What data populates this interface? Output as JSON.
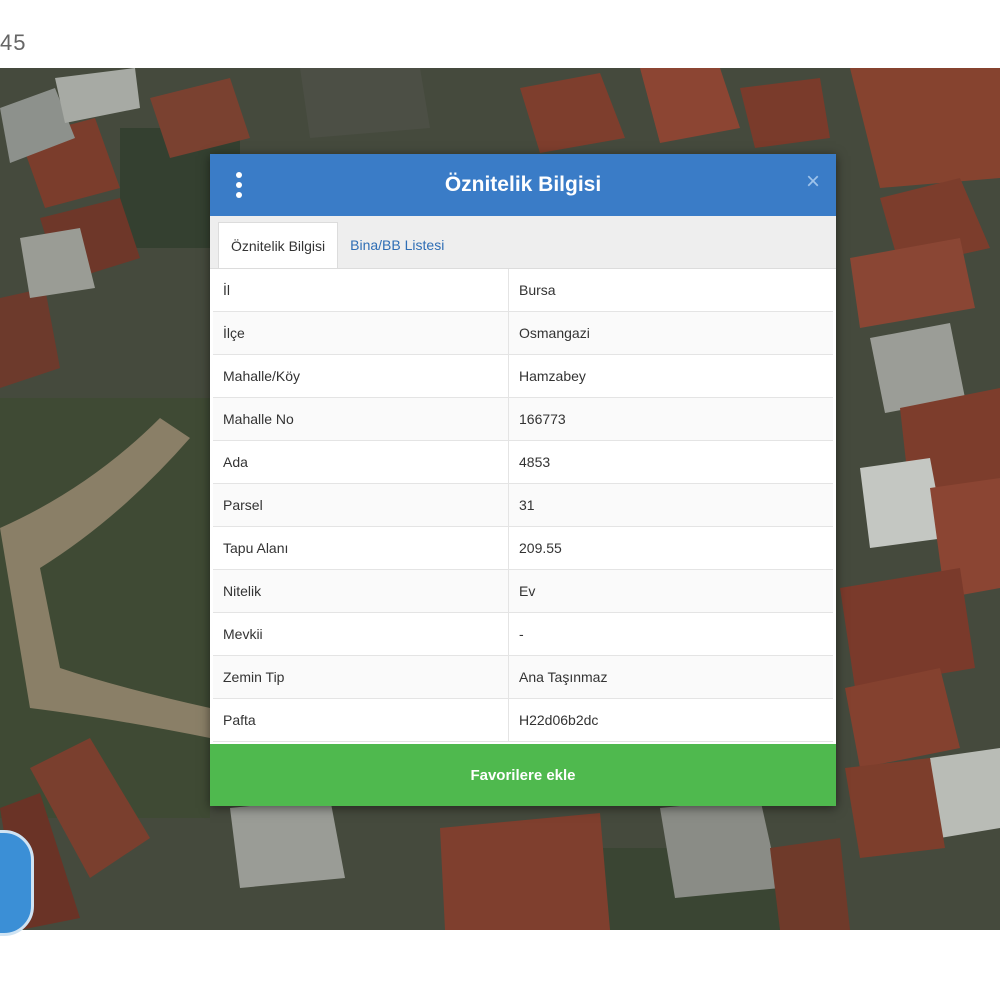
{
  "status_bar": {
    "time_fragment": "45"
  },
  "dialog": {
    "title": "Öznitelik Bilgisi",
    "menu_icon": "vertical-dots-icon",
    "close_icon": "close-icon",
    "close_symbol": "×",
    "tabs": [
      {
        "label": "Öznitelik Bilgisi",
        "active": true
      },
      {
        "label": "Bina/BB Listesi",
        "active": false
      }
    ],
    "rows": [
      {
        "key": "İl",
        "value": "Bursa"
      },
      {
        "key": "İlçe",
        "value": "Osmangazi"
      },
      {
        "key": "Mahalle/Köy",
        "value": "Hamzabey"
      },
      {
        "key": "Mahalle No",
        "value": "166773"
      },
      {
        "key": "Ada",
        "value": "4853"
      },
      {
        "key": "Parsel",
        "value": "31"
      },
      {
        "key": "Tapu Alanı",
        "value": "209.55"
      },
      {
        "key": "Nitelik",
        "value": "Ev"
      },
      {
        "key": "Mevkii",
        "value": "-"
      },
      {
        "key": "Zemin Tip",
        "value": "Ana Taşınmaz"
      },
      {
        "key": "Pafta",
        "value": "H22d06b2dc"
      }
    ],
    "favorite_button": "Favorilere ekle"
  },
  "colors": {
    "header_blue": "#3a7cc7",
    "tab_link_blue": "#2f6eb5",
    "button_green": "#4fb94e"
  }
}
